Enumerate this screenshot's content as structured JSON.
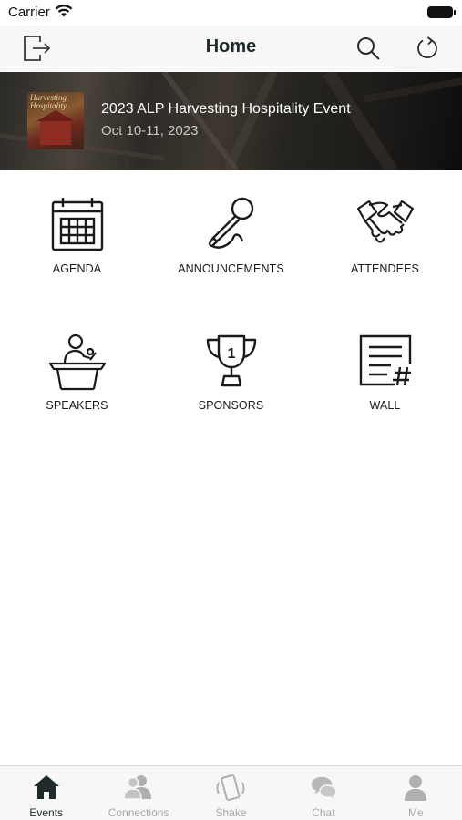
{
  "status_bar": {
    "carrier": "Carrier"
  },
  "nav": {
    "title": "Home"
  },
  "event": {
    "title": "2023 ALP Harvesting Hospitality Event",
    "date": "Oct 10-11, 2023",
    "thumbnail_text": "Harvesting Hospitality"
  },
  "tiles": [
    {
      "label": "AGENDA",
      "icon": "calendar-icon"
    },
    {
      "label": "ANNOUNCEMENTS",
      "icon": "microphone-icon"
    },
    {
      "label": "ATTENDEES",
      "icon": "handshake-icon"
    },
    {
      "label": "SPEAKERS",
      "icon": "podium-speaker-icon"
    },
    {
      "label": "SPONSORS",
      "icon": "trophy-icon"
    },
    {
      "label": "WALL",
      "icon": "hashtag-document-icon"
    }
  ],
  "tabs": [
    {
      "label": "Events",
      "icon": "home-icon",
      "active": true
    },
    {
      "label": "Connections",
      "icon": "people-icon",
      "active": false
    },
    {
      "label": "Shake",
      "icon": "phone-shake-icon",
      "active": false
    },
    {
      "label": "Chat",
      "icon": "chat-bubbles-icon",
      "active": false
    },
    {
      "label": "Me",
      "icon": "person-icon",
      "active": false
    }
  ],
  "colors": {
    "active_tab": "#1a2a2a",
    "inactive_tab": "#a8a8a8",
    "nav_bg": "#f7f7f7"
  }
}
